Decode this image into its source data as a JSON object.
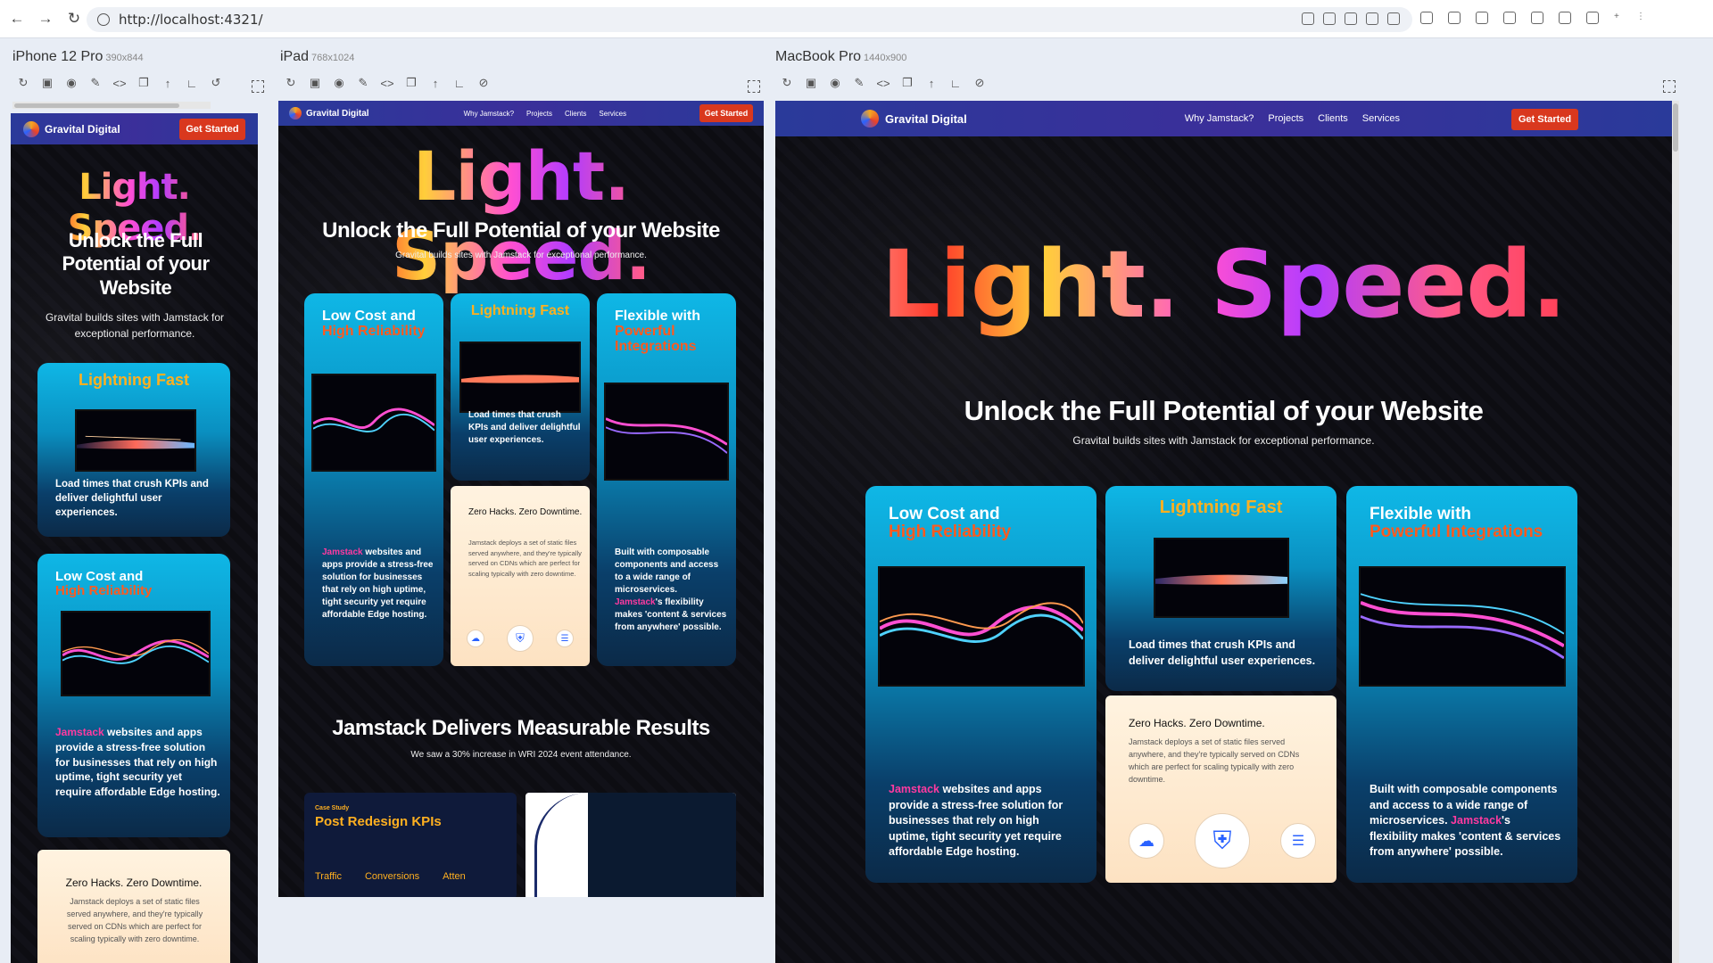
{
  "browser": {
    "url": "http://localhost:4321/"
  },
  "devices": [
    {
      "name": "iPhone 12 Pro",
      "dims": "390x844"
    },
    {
      "name": "iPad",
      "dims": "768x1024"
    },
    {
      "name": "MacBook Pro",
      "dims": "1440x900"
    }
  ],
  "site": {
    "brand": "Gravital Digital",
    "nav": [
      "Why Jamstack?",
      "Projects",
      "Clients",
      "Services"
    ],
    "cta": "Get Started",
    "hero": "Light. Speed.",
    "headline": "Unlock the Full Potential of your Website",
    "tagline": "Gravital builds sites with Jamstack for exceptional performance.",
    "cards": {
      "low_cost": {
        "title_1": "Low Cost and",
        "title_2": "High Reliability",
        "body_pink": "Jamstack",
        "body": " websites and apps provide a stress-free solution for businesses that rely on high uptime, tight security yet require affordable Edge hosting."
      },
      "lightning": {
        "title": "Lightning Fast",
        "body": "Load times that crush KPIs and deliver delightful user experiences."
      },
      "flexible": {
        "title_1": "Flexible with",
        "title_2": "Powerful Integrations",
        "body_1": "Built with composable components and access to a wide range of microservices. ",
        "body_pink": "Jamstack",
        "body_2": "'s flexibility makes 'content & services from anywhere' possible."
      },
      "zero": {
        "title": "Zero Hacks. Zero Downtime.",
        "body": "Jamstack deploys a set of static files served anywhere, and they're typically served on CDNs which are perfect for scaling typically with zero downtime."
      }
    },
    "results": {
      "title": "Jamstack Delivers Measurable Results",
      "subtitle": "We saw a 30% increase in WRI 2024 event attendance.",
      "case_label": "Case Study",
      "case_title": "Post Redesign KPIs",
      "kpis": [
        "Traffic",
        "Conversions",
        "Atten"
      ]
    }
  },
  "colors": {
    "nav_bg": "#2a3a9a",
    "cta": "#d9381e",
    "card_cyan": "#0fb7e6",
    "accent_orange": "#ff5a1f",
    "accent_pink": "#ff3aa0"
  }
}
